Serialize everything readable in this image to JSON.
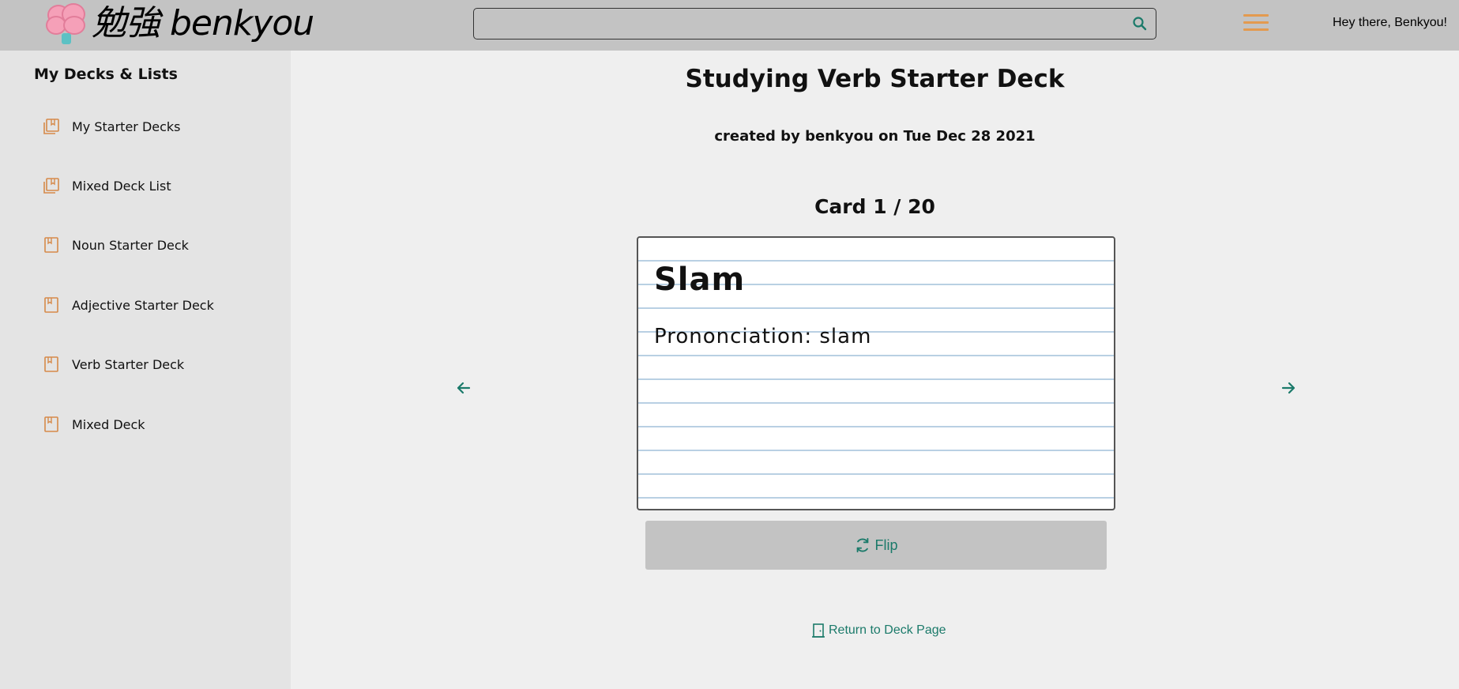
{
  "header": {
    "logo_text": "勉強 benkyou",
    "search_placeholder": "",
    "greeting": "Hey there, Benkyou!"
  },
  "sidebar": {
    "title": "My Decks & Lists",
    "items": [
      {
        "label": "My Starter Decks",
        "icon": "deck-list-icon"
      },
      {
        "label": "Mixed Deck List",
        "icon": "deck-list-icon"
      },
      {
        "label": "Noun Starter Deck",
        "icon": "deck-icon"
      },
      {
        "label": "Adjective Starter Deck",
        "icon": "deck-icon"
      },
      {
        "label": "Verb Starter Deck",
        "icon": "deck-icon"
      },
      {
        "label": "Mixed Deck",
        "icon": "deck-icon"
      }
    ]
  },
  "main": {
    "title": "Studying Verb Starter Deck",
    "subtitle": "created by benkyou on Tue Dec 28 2021",
    "card_counter": "Card 1 / 20",
    "card": {
      "word": "Slam",
      "pronunciation": "Prononciation: slam"
    },
    "flip_label": "Flip",
    "return_label": "Return to Deck Page"
  },
  "colors": {
    "header_bg": "#c3c3c3",
    "sidebar_bg": "#e4e4e4",
    "main_bg": "#efefef",
    "accent_orange": "#e39a4f",
    "accent_teal": "#1b7a6a",
    "card_line": "#b9d0e3"
  }
}
